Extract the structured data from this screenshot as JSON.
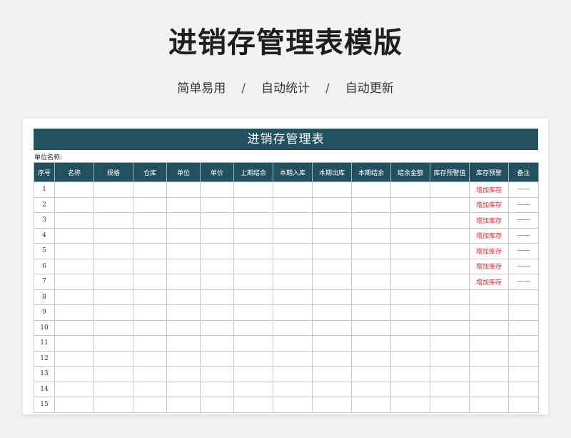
{
  "page": {
    "title": "进销存管理表模版",
    "subtitle": [
      "简单易用",
      "自动统计",
      "自动更新"
    ],
    "separator": "/"
  },
  "sheet": {
    "banner_title": "进销存管理表",
    "unit_label": "单位名称:",
    "header_color": "#22505f",
    "columns": [
      "序号",
      "名称",
      "规格",
      "仓库",
      "单位",
      "单价",
      "上期结余",
      "本期入库",
      "本期出库",
      "本期结余",
      "结余金额",
      "库存预警值",
      "库存预警",
      "备注"
    ],
    "rows": [
      {
        "no": "1",
        "alert": "增加库存",
        "note": "——"
      },
      {
        "no": "2",
        "alert": "增加库存",
        "note": "——"
      },
      {
        "no": "3",
        "alert": "增加库存",
        "note": "——"
      },
      {
        "no": "4",
        "alert": "增加库存",
        "note": "——"
      },
      {
        "no": "5",
        "alert": "增加库存",
        "note": "——"
      },
      {
        "no": "6",
        "alert": "增加库存",
        "note": "——"
      },
      {
        "no": "7",
        "alert": "增加库存",
        "note": "——"
      },
      {
        "no": "8",
        "alert": "",
        "note": ""
      },
      {
        "no": "9",
        "alert": "",
        "note": ""
      },
      {
        "no": "10",
        "alert": "",
        "note": ""
      },
      {
        "no": "11",
        "alert": "",
        "note": ""
      },
      {
        "no": "12",
        "alert": "",
        "note": ""
      },
      {
        "no": "13",
        "alert": "",
        "note": ""
      },
      {
        "no": "14",
        "alert": "",
        "note": ""
      },
      {
        "no": "15",
        "alert": "",
        "note": ""
      }
    ]
  }
}
